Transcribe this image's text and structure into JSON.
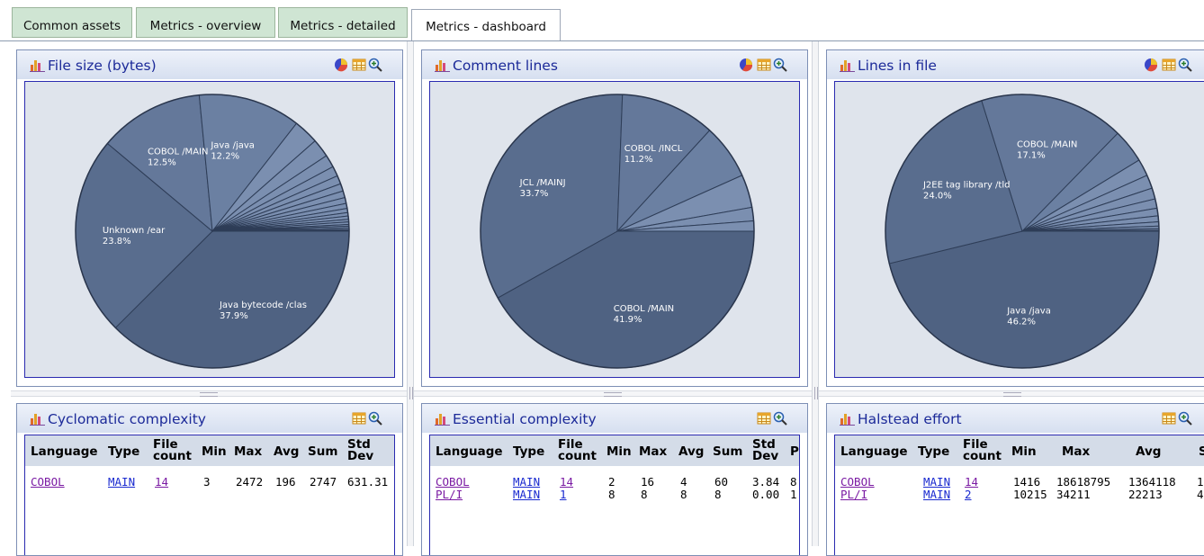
{
  "tabs": [
    {
      "label": "Common assets"
    },
    {
      "label": "Metrics - overview"
    },
    {
      "label": "Metrics - detailed"
    },
    {
      "label": "Metrics - dashboard"
    }
  ],
  "active_tab": "Metrics - dashboard",
  "colors": {
    "pie_slice": "#5b6f8f",
    "pie_edge": "#2e3d57",
    "panel_title": "#1c2a99",
    "link_visited": "#7a1aa3",
    "link": "#1a2ad0",
    "tab_inactive": "#cfe5d3"
  },
  "panels": {
    "file_size": {
      "title": "File size (bytes)",
      "icons": [
        "pie-chart-icon",
        "table-icon",
        "zoom-icon"
      ]
    },
    "comment_lines": {
      "title": "Comment lines",
      "icons": [
        "pie-chart-icon",
        "table-icon",
        "zoom-icon"
      ]
    },
    "lines_in_file": {
      "title": "Lines in file",
      "icons": [
        "pie-chart-icon",
        "table-icon",
        "zoom-icon"
      ]
    },
    "cyclomatic": {
      "title": "Cyclomatic complexity",
      "icons": [
        "table-icon",
        "zoom-icon"
      ]
    },
    "essential": {
      "title": "Essential complexity",
      "icons": [
        "table-icon",
        "zoom-icon"
      ]
    },
    "halstead": {
      "title": "Halstead effort",
      "icons": [
        "table-icon",
        "zoom-icon"
      ]
    }
  },
  "chart_data": [
    {
      "type": "pie",
      "title": "File size (bytes)",
      "slices": [
        {
          "label": "Java bytecode /clas",
          "pct": "37.9%",
          "value": 37.9
        },
        {
          "label": "Unknown /ear",
          "pct": "23.8%",
          "value": 23.8
        },
        {
          "label": "COBOL /MAIN",
          "pct": "12.5%",
          "value": 12.5
        },
        {
          "label": "Java /java",
          "pct": "12.2%",
          "value": 12.2
        },
        {
          "label": "",
          "pct": "",
          "value": 3.0
        },
        {
          "label": "",
          "pct": "",
          "value": 2.2
        },
        {
          "label": "",
          "pct": "",
          "value": 1.5
        },
        {
          "label": "",
          "pct": "",
          "value": 1.2
        },
        {
          "label": "",
          "pct": "",
          "value": 1.0
        },
        {
          "label": "",
          "pct": "",
          "value": 0.9
        },
        {
          "label": "",
          "pct": "",
          "value": 0.8
        },
        {
          "label": "",
          "pct": "",
          "value": 0.7
        },
        {
          "label": "",
          "pct": "",
          "value": 0.6
        },
        {
          "label": "",
          "pct": "",
          "value": 0.5
        },
        {
          "label": "",
          "pct": "",
          "value": 0.4
        },
        {
          "label": "",
          "pct": "",
          "value": 0.4
        },
        {
          "label": "",
          "pct": "",
          "value": 0.3
        },
        {
          "label": "",
          "pct": "",
          "value": 0.3
        },
        {
          "label": "",
          "pct": "",
          "value": 0.2
        },
        {
          "label": "",
          "pct": "",
          "value": 0.2
        },
        {
          "label": "",
          "pct": "",
          "value": 0.2
        },
        {
          "label": "",
          "pct": "",
          "value": 0.1
        },
        {
          "label": "",
          "pct": "",
          "value": 0.1
        }
      ]
    },
    {
      "type": "pie",
      "title": "Comment lines",
      "slices": [
        {
          "label": "COBOL /MAIN",
          "pct": "41.9%",
          "value": 41.9
        },
        {
          "label": "JCL /MAINJ",
          "pct": "33.7%",
          "value": 33.7
        },
        {
          "label": "COBOL /INCL",
          "pct": "11.2%",
          "value": 11.2
        },
        {
          "label": "",
          "pct": "",
          "value": 6.5
        },
        {
          "label": "",
          "pct": "",
          "value": 3.9
        },
        {
          "label": "",
          "pct": "",
          "value": 1.6
        },
        {
          "label": "",
          "pct": "",
          "value": 1.2
        }
      ]
    },
    {
      "type": "pie",
      "title": "Lines in file",
      "slices": [
        {
          "label": "Java /java",
          "pct": "46.2%",
          "value": 46.2
        },
        {
          "label": "J2EE tag library /tld",
          "pct": "24.0%",
          "value": 24.0
        },
        {
          "label": "COBOL /MAIN",
          "pct": "17.1%",
          "value": 17.1
        },
        {
          "label": "",
          "pct": "",
          "value": 4.0
        },
        {
          "label": "",
          "pct": "",
          "value": 2.0
        },
        {
          "label": "",
          "pct": "",
          "value": 1.6
        },
        {
          "label": "",
          "pct": "",
          "value": 1.3
        },
        {
          "label": "",
          "pct": "",
          "value": 1.1
        },
        {
          "label": "",
          "pct": "",
          "value": 0.9
        },
        {
          "label": "",
          "pct": "",
          "value": 0.7
        },
        {
          "label": "",
          "pct": "",
          "value": 0.5
        },
        {
          "label": "",
          "pct": "",
          "value": 0.3
        },
        {
          "label": "",
          "pct": "",
          "value": 0.2
        },
        {
          "label": "",
          "pct": "",
          "value": 0.1
        }
      ]
    }
  ],
  "tables": {
    "cyclomatic": {
      "headers": [
        "Language",
        "Type",
        "File count",
        "Min",
        "Max",
        "Avg",
        "Sum",
        "Std Dev"
      ],
      "rows": [
        [
          "COBOL",
          "MAIN",
          "14",
          "3",
          "2472",
          "196",
          "2747",
          "631.31"
        ]
      ]
    },
    "essential": {
      "headers": [
        "Language",
        "Type",
        "File count",
        "Min",
        "Max",
        "Avg",
        "Sum",
        "Std Dev",
        "P"
      ],
      "rows": [
        [
          "COBOL",
          "MAIN",
          "14",
          "2",
          "16",
          "4",
          "60",
          "3.84",
          "8"
        ],
        [
          "PL/I",
          "MAIN",
          "1",
          "8",
          "8",
          "8",
          "8",
          "0.00",
          "1"
        ]
      ]
    },
    "halstead": {
      "headers": [
        "Language",
        "Type",
        "File count",
        "Min",
        "Max",
        "Avg",
        "S"
      ],
      "rows": [
        [
          "COBOL",
          "MAIN",
          "14",
          "1416",
          "18618795",
          "1364118",
          "1"
        ],
        [
          "PL/I",
          "MAIN",
          "2",
          "10215",
          "34211",
          "22213",
          "4"
        ]
      ]
    }
  }
}
